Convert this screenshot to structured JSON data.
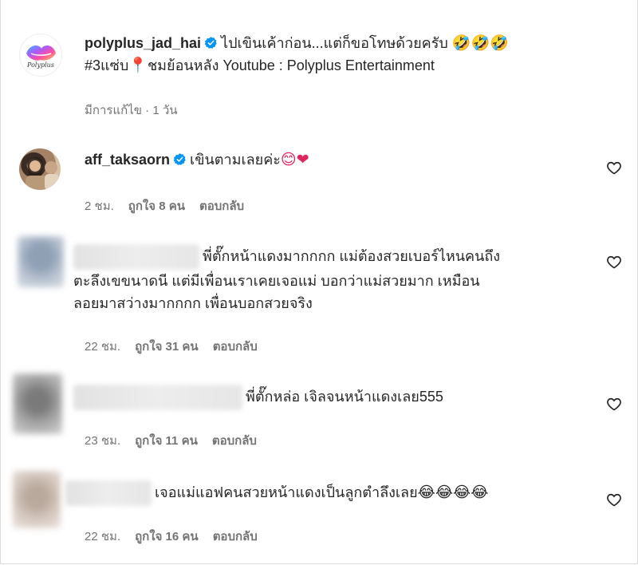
{
  "caption": {
    "username": "polyplus_jad_hai",
    "line1": "ไปเขินเค้าก่อน...แต่ก็ขอโทษด้วยครับ",
    "line1_emoji": "🤣🤣🤣",
    "line2_tag": "#3แซ่บ",
    "line2_pin": "📍",
    "line2_rest": "ชมย้อนหลัง Youtube : Polyplus Entertainment",
    "edited_label": "มีการแก้ไข · 1 วัน",
    "avatar_text": "Polyplus"
  },
  "comments": [
    {
      "username": "aff_taksaorn",
      "text": "เขินตามเลยค่ะ",
      "emoji": "😊❤",
      "time": "2 ชม.",
      "likes": "ถูกใจ 8 คน",
      "reply": "ตอบกลับ"
    },
    {
      "line1": "พี่ตั๊กหน้าแดงมากกกก แม่ต้องสวยเบอร์ไหนคนถึง",
      "line2": "ตะลึงเขขนาดนี แต่มีเพื่อนเราเคยเจอแม่ บอกว่าแม่สวยมาก เหมือน",
      "line3": "ลอยมาสว่างมากกกก เพื่อนบอกสวยจริง",
      "time": "22 ชม.",
      "likes": "ถูกใจ 31 คน",
      "reply": "ตอบกลับ"
    },
    {
      "text": "พี่ตั๊กหล่อ เจิลจนหน้าแดงเลย555",
      "time": "23 ชม.",
      "likes": "ถูกใจ 11 คน",
      "reply": "ตอบกลับ"
    },
    {
      "text": "เจอแม่แอฟคนสวยหน้าแดงเป็นลูกตำลึงเลย",
      "emoji": "😂😂😂😂",
      "time": "22 ชม.",
      "likes": "ถูกใจ 16 คน",
      "reply": "ตอบกลับ"
    }
  ],
  "colors": {
    "text": "#262626",
    "meta": "#737373",
    "verified": "#0095f6",
    "heart_red": "#e0245e"
  }
}
